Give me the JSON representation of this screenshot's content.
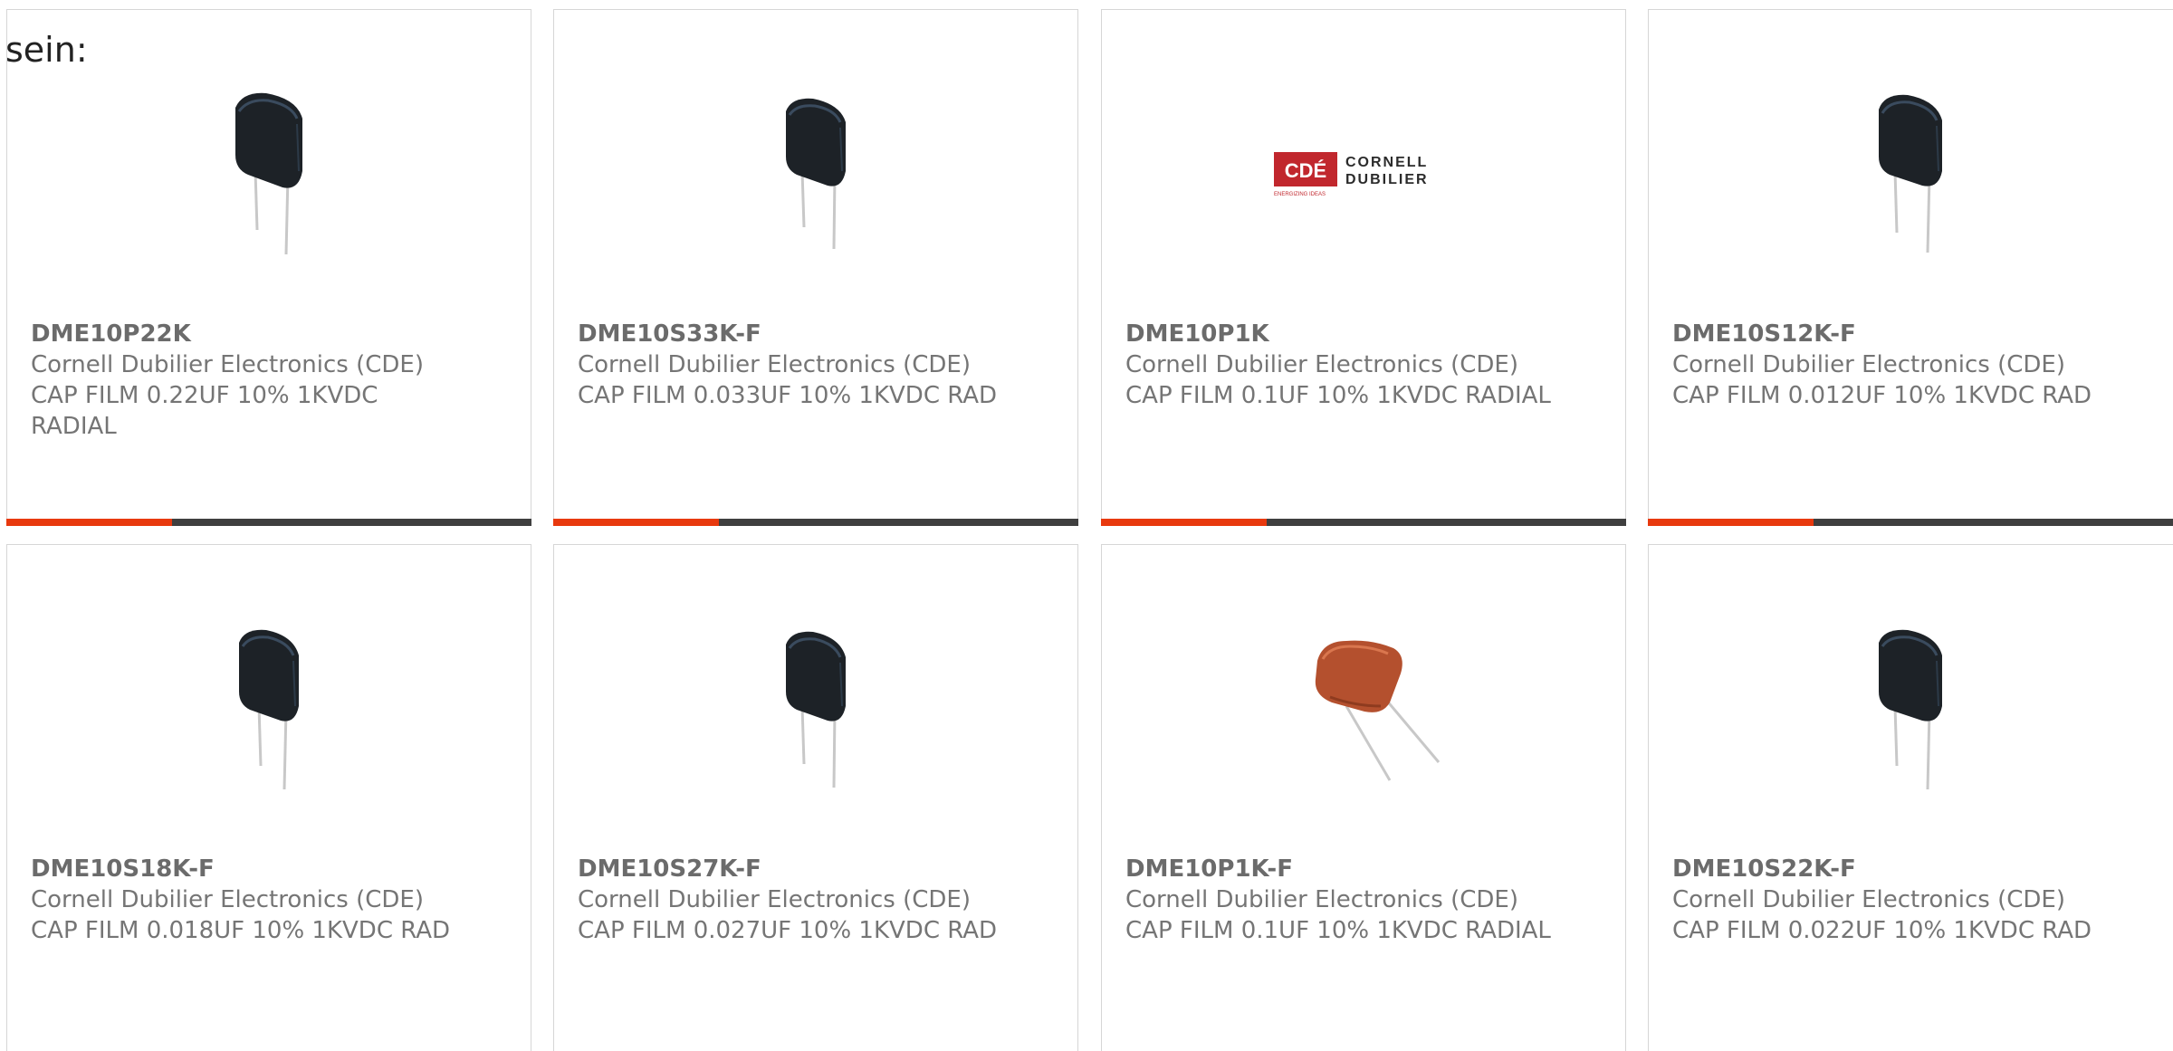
{
  "intro_text": "sein:",
  "colors": {
    "accent": "#e8390e",
    "bar": "#3f3f3f",
    "text": "#757575"
  },
  "products": [
    {
      "part": "DME10P22K",
      "manufacturer": "Cornell Dubilier Electronics (CDE)",
      "description": "CAP FILM 0.22UF 10% 1KVDC RADIAL",
      "image": "black-film-capacitor"
    },
    {
      "part": "DME10S33K-F",
      "manufacturer": "Cornell Dubilier Electronics (CDE)",
      "description": "CAP FILM 0.033UF 10% 1KVDC RAD",
      "image": "black-film-capacitor"
    },
    {
      "part": "DME10P1K",
      "manufacturer": "Cornell Dubilier Electronics (CDE)",
      "description": "CAP FILM 0.1UF 10% 1KVDC RADIAL",
      "image": "cde-logo",
      "logo_text": [
        "CDÉ",
        "CORNELL",
        "DUBILIER",
        "ENERGIZING IDEAS"
      ]
    },
    {
      "part": "DME10S12K-F",
      "manufacturer": "Cornell Dubilier Electronics (CDE)",
      "description": "CAP FILM 0.012UF 10% 1KVDC RAD",
      "image": "black-film-capacitor"
    },
    {
      "part": "DME10S18K-F",
      "manufacturer": "Cornell Dubilier Electronics (CDE)",
      "description": "CAP FILM 0.018UF 10% 1KVDC RAD",
      "image": "black-film-capacitor"
    },
    {
      "part": "DME10S27K-F",
      "manufacturer": "Cornell Dubilier Electronics (CDE)",
      "description": "CAP FILM 0.027UF 10% 1KVDC RAD",
      "image": "black-film-capacitor"
    },
    {
      "part": "DME10P1K-F",
      "manufacturer": "Cornell Dubilier Electronics (CDE)",
      "description": "CAP FILM 0.1UF 10% 1KVDC RADIAL",
      "image": "orange-film-capacitor"
    },
    {
      "part": "DME10S22K-F",
      "manufacturer": "Cornell Dubilier Electronics (CDE)",
      "description": "CAP FILM 0.022UF 10% 1KVDC RAD",
      "image": "black-film-capacitor"
    }
  ]
}
